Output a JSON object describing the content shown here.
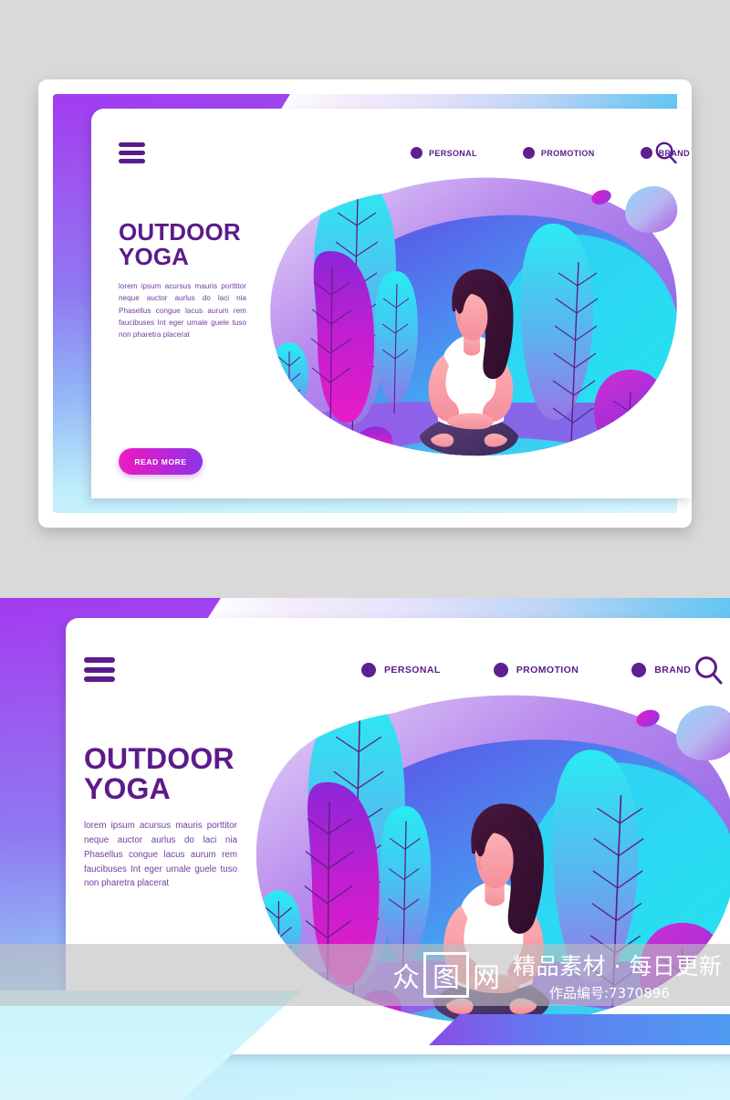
{
  "meta": {
    "background_color": "#d9d9d9",
    "accent_purple": "#5b1b8a",
    "accent_magenta": "#f020c8",
    "accent_cyan": "#2ae8f0"
  },
  "header": {
    "menu_icon": "hamburger-icon",
    "search_icon": "search-icon",
    "nav_items": [
      {
        "label": "PERSONAL"
      },
      {
        "label": "PROMOTION"
      },
      {
        "label": "BRAND"
      }
    ]
  },
  "hero": {
    "title_line1": "OUTDOOR",
    "title_line2": "YOGA",
    "body": "lorem ipsum acursus mauris porttitor neque auctor aurlus do laci nia Phasellus congue lacus aurum rem faucibuses Int eger urnale guele tuso non pharetra placerat",
    "cta_label": "READ MORE"
  },
  "illustration": {
    "name": "woman-meditating-lotus-pose",
    "scene": "outdoor-park-with-stylized-trees",
    "figure": {
      "hair_color": "#3a1133",
      "skin_color": "#f9a0a6",
      "shirt_color": "#ffffff",
      "pants_color": "#4a3468"
    }
  },
  "watermark": {
    "logo_chars": [
      "众",
      "图",
      "网"
    ],
    "tagline": "精品素材 · 每日更新",
    "work_id": "作品编号:7370896"
  }
}
